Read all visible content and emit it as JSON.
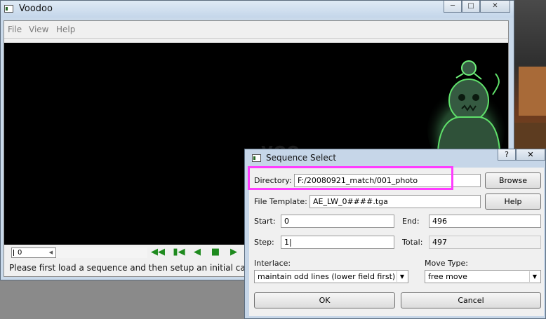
{
  "window": {
    "title": "Voodoo",
    "controls": [
      "minimize-icon",
      "maximize-icon",
      "close-icon"
    ],
    "menu": [
      {
        "label": "File"
      },
      {
        "label": "View"
      },
      {
        "label": "Help"
      }
    ],
    "frame_value": "0",
    "playback_buttons": [
      "first-frame-icon",
      "prev-key-icon",
      "prev-frame-icon",
      "stop-icon",
      "play-icon"
    ],
    "status": "Please first load a sequence and then setup an initial came"
  },
  "dialog": {
    "title": "Sequence Select",
    "directory_label": "Directory:",
    "directory_value": "F:/20080921_match/001_photo",
    "browse_label": "Browse",
    "template_label": "File Template:",
    "template_value": "AE_LW_0####.tga",
    "help_label": "Help",
    "start_label": "Start:",
    "start_value": "0",
    "end_label": "End:",
    "end_value": "496",
    "step_label": "Step:",
    "step_value": "1|",
    "total_label": "Total:",
    "total_value": "497",
    "interlace_label": "Interlace:",
    "interlace_value": "maintain odd lines (lower field first)",
    "move_type_label": "Move Type:",
    "move_type_value": "free move",
    "ok_label": "OK",
    "cancel_label": "Cancel"
  },
  "colors": {
    "highlight": "#ff3cff",
    "playback_green": "#1e8a1e"
  }
}
